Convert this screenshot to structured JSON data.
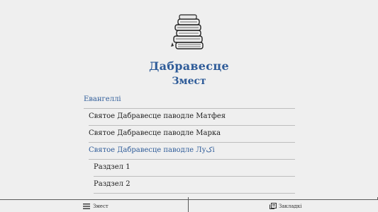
{
  "app": {
    "title": "Дабравесце",
    "subtitle": "Змест"
  },
  "toc": {
    "items": [
      {
        "label": "Евангеллі",
        "active": true
      },
      {
        "label": "Святое Дабравесце паводле Матфея",
        "active": false
      },
      {
        "label": "Святое Дабравесце паводле Марка",
        "active": false
      },
      {
        "label": "Святое Дабравесце паводле Луکі",
        "active": true
      },
      {
        "label": "Раздзел 1",
        "active": false
      },
      {
        "label": "Раздзел 2",
        "active": false
      }
    ]
  },
  "tabbar": {
    "contents_label": "Змест",
    "bookmarks_label": "Закладкі",
    "contents_icon": "menu-icon",
    "bookmarks_icon": "bookmarks-icon"
  },
  "colors": {
    "accent": "#2f5c99",
    "background": "#efefef",
    "divider": "#bdbdbd"
  }
}
